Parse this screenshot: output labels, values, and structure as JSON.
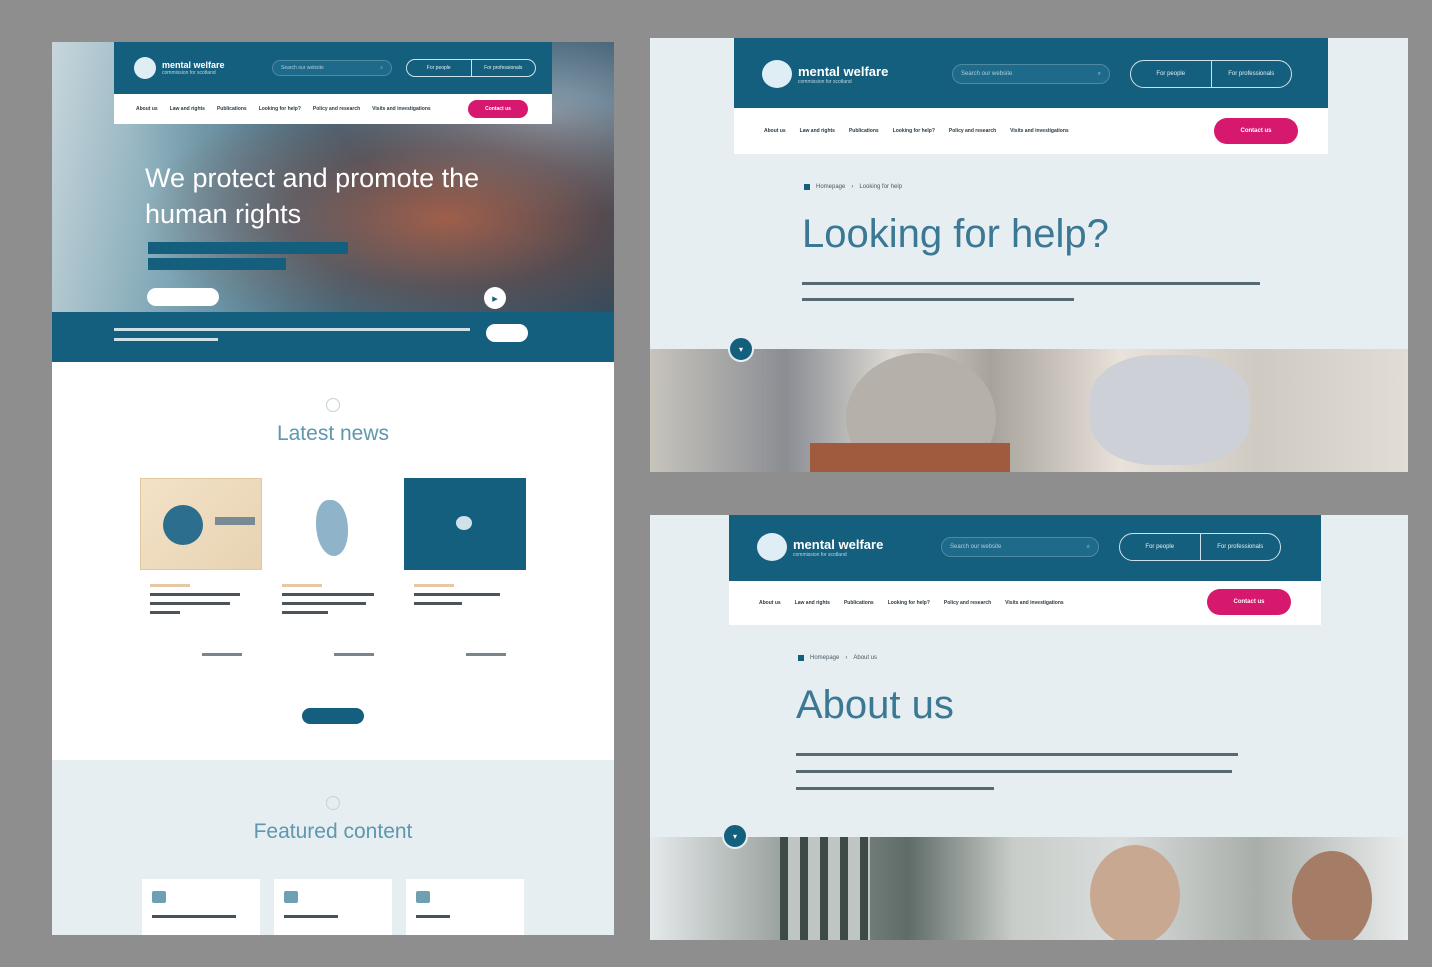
{
  "brand": {
    "name": "mental welfare",
    "tagline": "commission for scotland"
  },
  "nav": {
    "search_placeholder": "Search our website",
    "pill_left": "For people",
    "pill_right": "For professionals",
    "items": [
      "About us",
      "Law and rights",
      "Publications",
      "Looking for help?",
      "Policy and research",
      "Visits and investigations"
    ],
    "contact_label": "Contact us"
  },
  "home": {
    "hero_title": "We protect and promote the human rights",
    "latest_news_title": "Latest news",
    "featured_title": "Featured content"
  },
  "help_page": {
    "breadcrumb_home": "Homepage",
    "breadcrumb_current": "Looking for help",
    "title": "Looking for help?"
  },
  "about_page": {
    "breadcrumb_home": "Homepage",
    "breadcrumb_current": "About us",
    "title": "About us"
  },
  "colors": {
    "brand_teal": "#155f7e",
    "accent_pink": "#d6186e",
    "page_bg": "#e6eef2",
    "frame_gray": "#8e8e8e"
  },
  "icons": [
    "search-icon",
    "home-icon",
    "arrow-down-icon",
    "play-icon",
    "logo-mark-icon"
  ]
}
